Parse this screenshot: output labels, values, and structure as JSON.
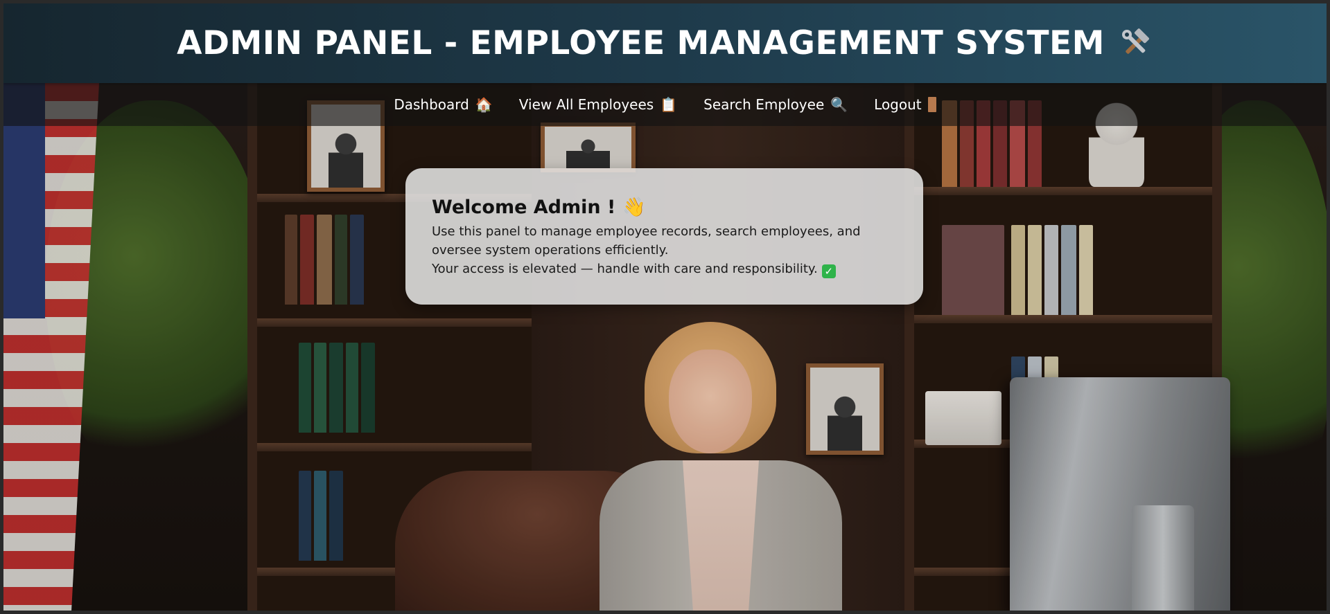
{
  "header": {
    "title": "ADMIN PANEL - EMPLOYEE MANAGEMENT SYSTEM",
    "icon": "tools-icon"
  },
  "nav": {
    "items": [
      {
        "label": "Dashboard",
        "icon": "house-icon",
        "glyph": "🏠"
      },
      {
        "label": "View All Employees",
        "icon": "clipboard-icon",
        "glyph": "📋"
      },
      {
        "label": "Search Employee",
        "icon": "magnifier-icon",
        "glyph": "🔍"
      },
      {
        "label": "Logout",
        "icon": "door-icon"
      }
    ]
  },
  "welcome": {
    "title": "Welcome Admin !",
    "title_icon": "waving-hand-icon",
    "title_glyph": "👋",
    "line1": "Use this panel to manage employee records, search employees, and oversee system operations efficiently.",
    "line2": "Your access is elevated — handle with care and responsibility.",
    "line2_icon": "check-mark-icon",
    "check_glyph": "✓"
  },
  "colors": {
    "header_gradient_start": "#16262f",
    "header_gradient_end": "#2a5468",
    "card_background": "#e8e8e8",
    "check_green": "#2fb34a"
  }
}
